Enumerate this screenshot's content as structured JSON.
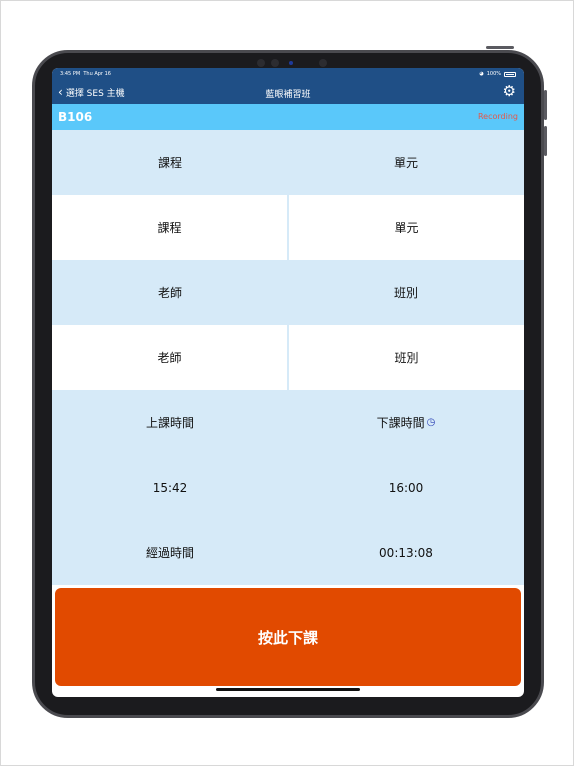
{
  "status_bar": {
    "time": "3:45 PM",
    "date": "Thu Apr 16",
    "wifi": "wifi-icon",
    "battery_text": "100%"
  },
  "nav": {
    "back_label": "選擇 SES 主機",
    "title": "藍眼補習班",
    "settings_icon": "gear-icon"
  },
  "room": {
    "name": "B106",
    "status": "Recording"
  },
  "table": {
    "course_header": "課程",
    "unit_header": "單元",
    "course_value": "課程",
    "unit_value": "單元",
    "teacher_header": "老師",
    "class_header": "班別",
    "teacher_value": "老師",
    "class_value": "班別",
    "start_time_label": "上課時間",
    "end_time_label": "下課時間",
    "start_time": "15:42",
    "end_time": "16:00",
    "elapsed_label": "經過時間",
    "elapsed_value": "00:13:08"
  },
  "end_button": {
    "label": "按此下課"
  },
  "colors": {
    "nav": "#1f4f86",
    "room_bar": "#5ac8fa",
    "row_blue": "#d6eaf8",
    "end_button": "#e14a00",
    "recording": "#e5584a"
  }
}
